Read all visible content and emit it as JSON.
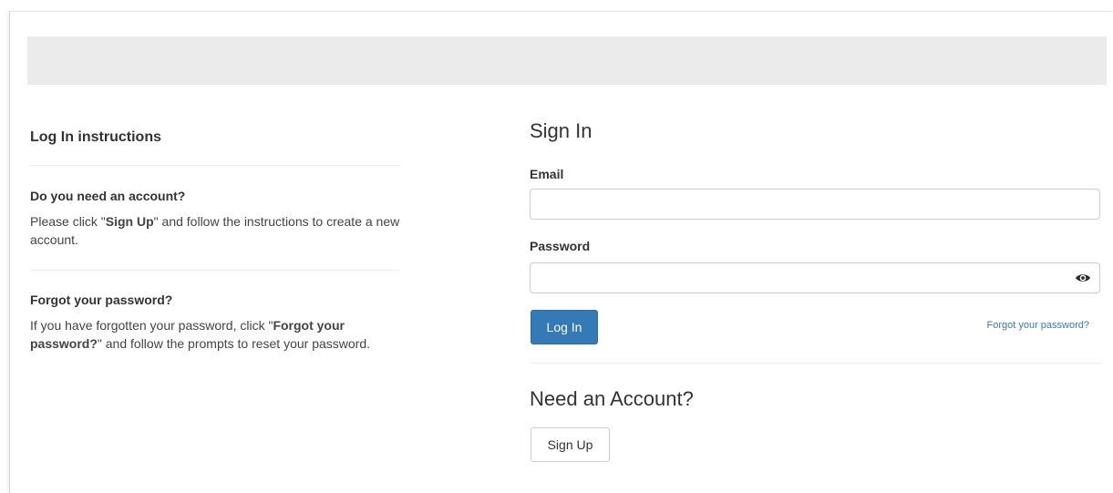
{
  "instructions": {
    "title": "Log In instructions",
    "need_account": {
      "heading": "Do you need an account?",
      "text_before": "Please click \"",
      "text_bold": "Sign Up",
      "text_after": "\" and follow the instructions to create a new account."
    },
    "forgot": {
      "heading": "Forgot your password?",
      "text_before": "If you have forgotten your password, click \"",
      "text_bold": "Forgot your password?",
      "text_after": "\" and follow the prompts to reset your password."
    }
  },
  "signin": {
    "title": "Sign In",
    "email_label": "Email",
    "email_value": "",
    "password_label": "Password",
    "password_value": "",
    "password_toggle_icon": "eye-icon",
    "login_button": "Log In",
    "forgot_link": "Forgot your password?",
    "need_account_title": "Need an Account?",
    "signup_button": "Sign Up"
  },
  "colors": {
    "primary": "#337ab7",
    "top_bar": "#ebebeb"
  }
}
